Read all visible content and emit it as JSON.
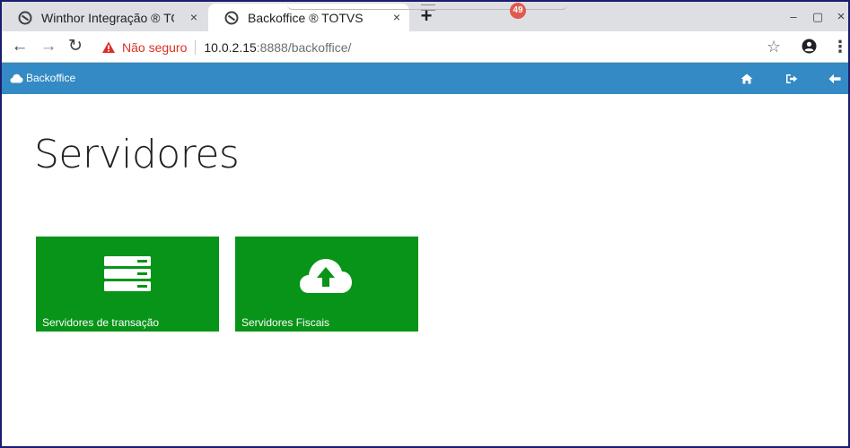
{
  "browser": {
    "tabs": [
      {
        "title": "Winthor Integração ® TOTVS",
        "active": false,
        "close": "×"
      },
      {
        "title": "Backoffice ® TOTVS",
        "active": true,
        "close": "×"
      }
    ],
    "new_tab": "+",
    "notification_count": "49",
    "window_controls": {
      "minimize": "–",
      "maximize": "▢",
      "close": "×"
    },
    "nav": {
      "back": "←",
      "forward": "→",
      "reload": "↻"
    },
    "address": {
      "security_label": "Não seguro",
      "url_host": "10.0.2.15",
      "url_rest": ":8888/backoffice/"
    },
    "bookmark_icon": "☆",
    "menu_icon": "⋮"
  },
  "app": {
    "brand": "Backoffice",
    "header_icons": [
      "home-icon",
      "logout-icon",
      "back-arrow-icon"
    ],
    "accent_color": "#338ac4"
  },
  "main": {
    "title": "Servidores",
    "tiles": [
      {
        "label": "Servidores de transação",
        "icon": "server-stack-icon"
      },
      {
        "label": "Servidores Fiscais",
        "icon": "cloud-upload-icon"
      }
    ],
    "tile_color": "#079418"
  }
}
